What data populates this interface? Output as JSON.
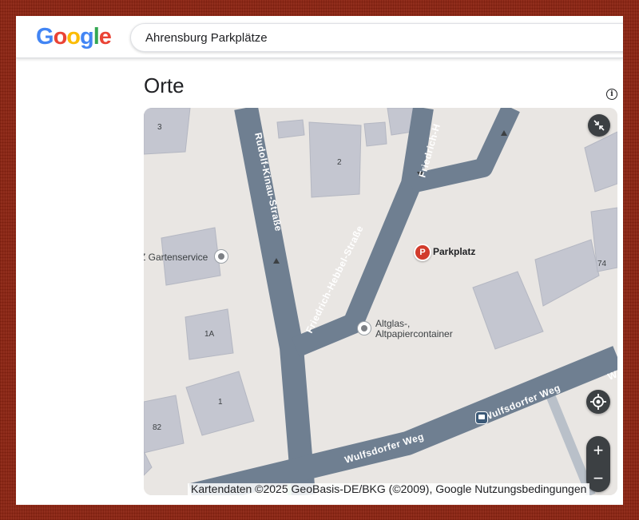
{
  "header": {
    "logo_letters": [
      "G",
      "o",
      "o",
      "g",
      "l",
      "e"
    ],
    "search_query": "Ahrensburg Parkplätze"
  },
  "section": {
    "title": "Orte",
    "info_icon": "info-icon"
  },
  "map": {
    "streets": [
      "Rudolf-Kinau-Straße",
      "Friedrich-Hebbel-Straße",
      "Friedrich-H",
      "Wulfsdorfer Weg",
      "Wulfsdorfer Weg",
      "W"
    ],
    "house_numbers": [
      "3",
      "2",
      "74",
      "1A",
      "1",
      "82"
    ],
    "pois": {
      "parking_pin_letter": "P",
      "parking": "Parkplatz",
      "container_line1": "Altglas-,",
      "container_line2": "Altpapiercontainer",
      "garden": "Z Gartenservice"
    },
    "controls": {
      "collapse_icon": "collapse-icon",
      "locate_icon": "locate-icon",
      "zoom_in": "+",
      "zoom_out": "−"
    },
    "attribution": "Kartendaten ©2025 GeoBasis-DE/BKG (©2009), Google   Nutzungsbedingungen"
  }
}
